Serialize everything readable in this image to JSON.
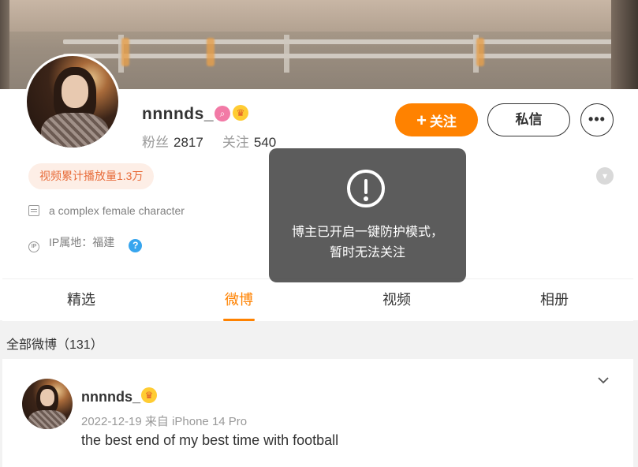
{
  "profile": {
    "name": "nnnnds_",
    "fans_label": "粉丝",
    "fans_count": "2817",
    "following_label": "关注",
    "following_count": "540",
    "follow_button": "关注",
    "follow_plus": "+",
    "message_button": "私信",
    "more_button": "•••",
    "play_count_badge": "视频累计播放量1.3万",
    "bio": "a complex female character",
    "ip_location": "IP属地：福建",
    "help_symbol": "?"
  },
  "tabs": [
    "精选",
    "微博",
    "视频",
    "相册"
  ],
  "active_tab": "微博",
  "toast": {
    "message": "博主已开启一键防护模式，暂时无法关注"
  },
  "feed": {
    "count_title": "全部微博（131）",
    "post": {
      "author": "nnnnds_",
      "meta": "2022-12-19 来自 iPhone 14 Pro",
      "text": "the best end of my best time with football"
    }
  },
  "colors": {
    "accent": "#ff8200",
    "badge_bg": "#fdeee6",
    "badge_text": "#e86c3a",
    "help_blue": "#37a5ee",
    "toast_bg": "#505050"
  },
  "icons": [
    "pink-v-badge-icon",
    "crown-badge-icon",
    "expand-icon",
    "doc-icon",
    "ip-icon",
    "help-icon",
    "warning-icon",
    "chevron-down-icon"
  ]
}
